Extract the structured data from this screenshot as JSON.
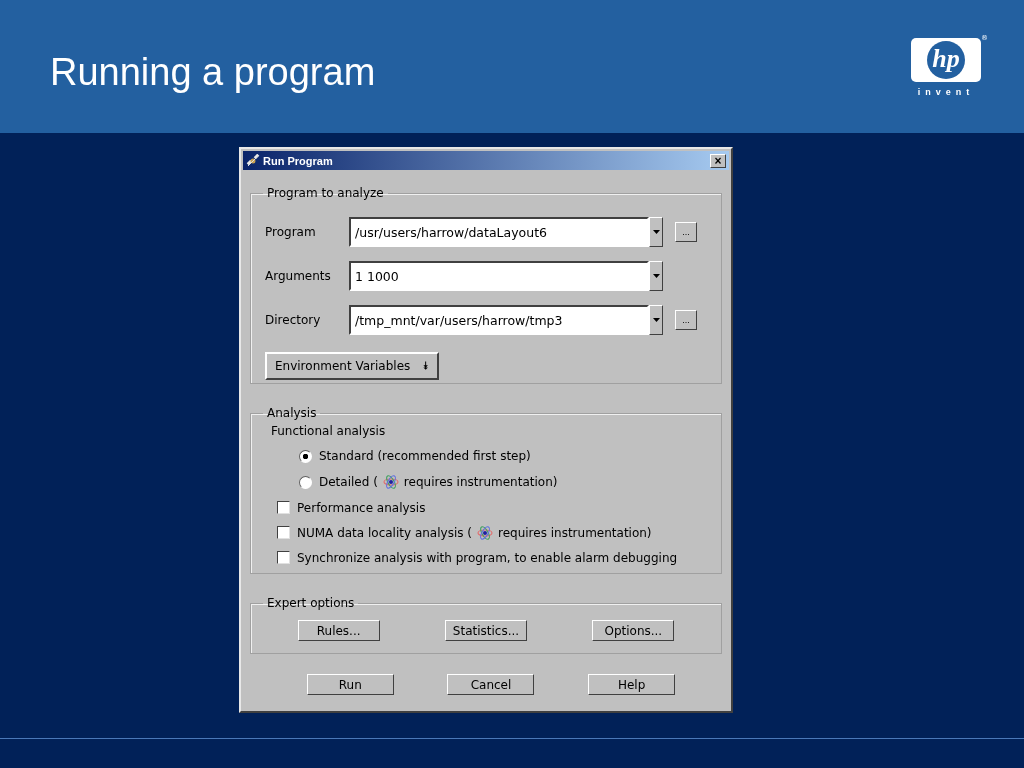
{
  "slide": {
    "title": "Running a program",
    "logo": {
      "mark": "hp",
      "registered": "®",
      "tagline": "invent"
    }
  },
  "window": {
    "title": "Run Program",
    "close": "×"
  },
  "program_group": {
    "legend": "Program to analyze",
    "fields": [
      {
        "label": "Program",
        "value": "/usr/users/harrow/dataLayout6",
        "browse": "..."
      },
      {
        "label": "Arguments",
        "value": "1 1000"
      },
      {
        "label": "Directory",
        "value": "/tmp_mnt/var/users/harrow/tmp3",
        "browse": "..."
      }
    ],
    "env_button": {
      "label": "Environment Variables",
      "icon": "⯯"
    }
  },
  "analysis": {
    "legend": "Analysis",
    "subheading": "Functional analysis",
    "options": [
      {
        "kind": "radio",
        "label": "Standard (recommended first step)",
        "selected": true
      },
      {
        "kind": "radio",
        "label": "Detailed (",
        "note": "requires instrumentation)",
        "selected": false
      },
      {
        "kind": "checkbox",
        "label": "Performance analysis",
        "checked": false
      },
      {
        "kind": "checkbox",
        "label": "NUMA data locality analysis (",
        "note": "requires instrumentation)",
        "checked": false
      },
      {
        "kind": "checkbox",
        "label": "Synchronize analysis with program, to enable alarm debugging",
        "checked": false
      }
    ]
  },
  "expert_options": {
    "legend": "Expert options",
    "buttons": [
      "Rules...",
      "Statistics...",
      "Options..."
    ]
  },
  "buttons": [
    "Run",
    "Cancel",
    "Help"
  ]
}
